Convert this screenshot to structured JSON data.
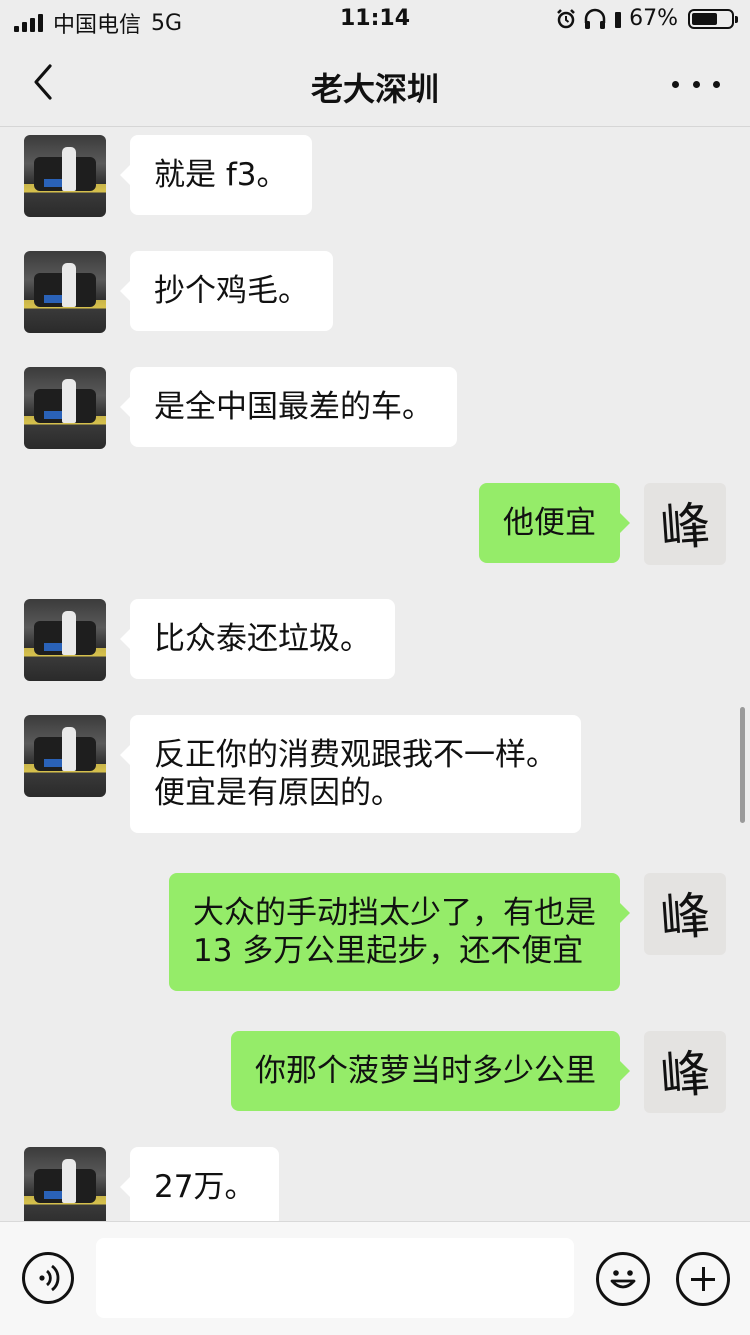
{
  "status_bar": {
    "carrier": "中国电信",
    "network": "5G",
    "time": "11:14",
    "battery_percent": "67%",
    "battery_level": 0.67
  },
  "nav": {
    "title": "老大深圳"
  },
  "avatars": {
    "right_glyph": "峰"
  },
  "messages": [
    {
      "side": "left",
      "lines": [
        "就是 f3。"
      ]
    },
    {
      "side": "left",
      "lines": [
        "抄个鸡毛。"
      ]
    },
    {
      "side": "left",
      "lines": [
        "是全中国最差的车。"
      ]
    },
    {
      "side": "right",
      "lines": [
        "他便宜"
      ]
    },
    {
      "side": "left",
      "lines": [
        "比众泰还垃圾。"
      ]
    },
    {
      "side": "left",
      "lines": [
        "反正你的消费观跟我不一样。",
        "便宜是有原因的。"
      ]
    },
    {
      "side": "right",
      "lines": [
        "大众的手动挡太少了，有也是",
        "13 多万公里起步，还不便宜"
      ]
    },
    {
      "side": "right",
      "lines": [
        "你那个菠萝当时多少公里"
      ]
    },
    {
      "side": "left",
      "lines": [
        "27万。"
      ]
    }
  ],
  "input": {
    "value": "",
    "placeholder": ""
  },
  "colors": {
    "background": "#ededed",
    "bubble_self": "#95ec69",
    "bubble_other": "#ffffff"
  }
}
